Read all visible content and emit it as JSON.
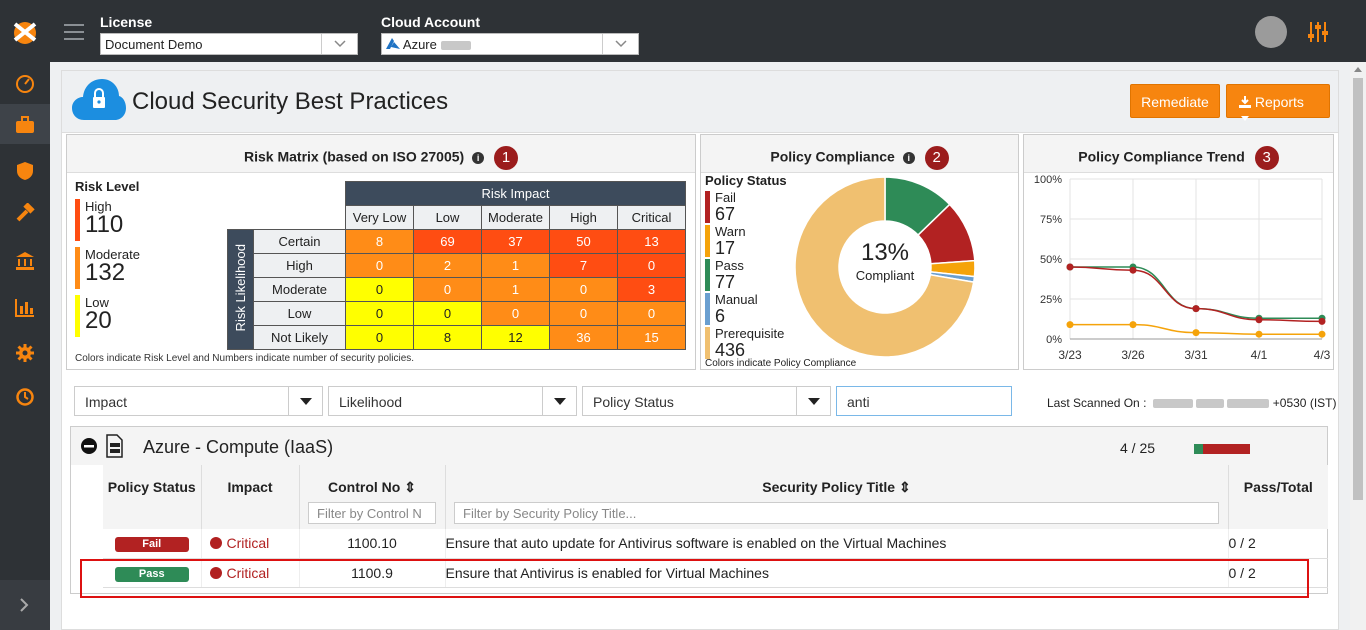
{
  "topbar": {
    "license_label": "License",
    "license_value": "Document Demo",
    "cloud_label": "Cloud Account",
    "cloud_value": "Azure"
  },
  "sidebar": {
    "items": [
      "dashboard-icon",
      "briefcase-icon",
      "shield-icon",
      "hammer-icon",
      "bank-icon",
      "bar-chart-icon",
      "gear-icon",
      "history-icon"
    ]
  },
  "page": {
    "title": "Cloud Security Best Practices",
    "remediate_label": "Remediate",
    "reports_label": "Reports"
  },
  "risk_matrix": {
    "title": "Risk Matrix (based on ISO 27005)",
    "badge": "1",
    "risk_level_title": "Risk Level",
    "levels": [
      {
        "name": "High",
        "value": "110",
        "color": "#ff4d12"
      },
      {
        "name": "Moderate",
        "value": "132",
        "color": "#ff8c17"
      },
      {
        "name": "Low",
        "value": "20",
        "color": "#ffff00"
      }
    ],
    "impact_header": "Risk Impact",
    "likelihood_header": "Risk Likelihood",
    "impact_cols": [
      "Very Low",
      "Low",
      "Moderate",
      "High",
      "Critical"
    ],
    "rows": [
      {
        "label": "Certain",
        "values": [
          "8",
          "69",
          "37",
          "50",
          "13"
        ]
      },
      {
        "label": "High",
        "values": [
          "0",
          "2",
          "1",
          "7",
          "0"
        ]
      },
      {
        "label": "Moderate",
        "values": [
          "0",
          "0",
          "1",
          "0",
          "3"
        ]
      },
      {
        "label": "Low",
        "values": [
          "0",
          "0",
          "0",
          "0",
          "0"
        ]
      },
      {
        "label": "Not Likely",
        "values": [
          "0",
          "8",
          "12",
          "36",
          "15"
        ]
      }
    ],
    "footnote": "Colors indicate Risk Level and Numbers indicate number of security policies."
  },
  "policy_compliance": {
    "title": "Policy Compliance",
    "badge": "2",
    "status_title": "Policy Status",
    "statuses": [
      {
        "name": "Fail",
        "value": "67",
        "color": "#b22222"
      },
      {
        "name": "Warn",
        "value": "17",
        "color": "#f5a30a"
      },
      {
        "name": "Pass",
        "value": "77",
        "color": "#2e8b57"
      },
      {
        "name": "Manual",
        "value": "6",
        "color": "#6a9fd0"
      },
      {
        "name": "Prerequisite",
        "value": "436",
        "color": "#f0c070"
      }
    ],
    "percent": "13%",
    "percent_label": "Compliant",
    "footnote": "Colors indicate Policy Compliance"
  },
  "trend": {
    "title": "Policy Compliance Trend",
    "badge": "3"
  },
  "chart_data": {
    "type": "line",
    "x": [
      "3/23",
      "3/26",
      "3/31",
      "4/1",
      "4/3"
    ],
    "ylim": [
      0,
      100
    ],
    "yticks": [
      "100%",
      "75%",
      "50%",
      "25%",
      "0%"
    ],
    "series": [
      {
        "values": [
          45,
          45,
          19,
          13,
          13
        ],
        "color": "#2e8b57"
      },
      {
        "values": [
          45,
          43,
          19,
          12,
          11
        ],
        "color": "#b22222"
      },
      {
        "values": [
          9,
          9,
          4,
          3,
          3
        ],
        "color": "#f5a30a"
      }
    ]
  },
  "filters": {
    "impact": "Impact",
    "likelihood": "Likelihood",
    "policy_status": "Policy Status",
    "search_value": "anti",
    "last_scanned_label": "Last Scanned On :",
    "last_scanned_tz": "+0530 (IST)"
  },
  "group": {
    "title": "Azure - Compute (IaaS)",
    "count": "4 / 25",
    "columns": {
      "status": "Policy Status",
      "impact": "Impact",
      "control": "Control No",
      "title": "Security Policy Title",
      "pass_total": "Pass/Total"
    },
    "control_filter_placeholder": "Filter by Control N",
    "title_filter_placeholder": "Filter by Security Policy Title...",
    "rows": [
      {
        "status": "Fail",
        "status_color": "#b22222",
        "impact": "Critical",
        "control": "1100.10",
        "title": "Ensure that auto update for Antivirus software is enabled on the Virtual Machines",
        "pass_total": "0 / 2"
      },
      {
        "status": "Pass",
        "status_color": "#2e8b57",
        "impact": "Critical",
        "control": "1100.9",
        "title": "Ensure that Antivirus is enabled for Virtual Machines",
        "pass_total": "0 / 2"
      }
    ]
  }
}
